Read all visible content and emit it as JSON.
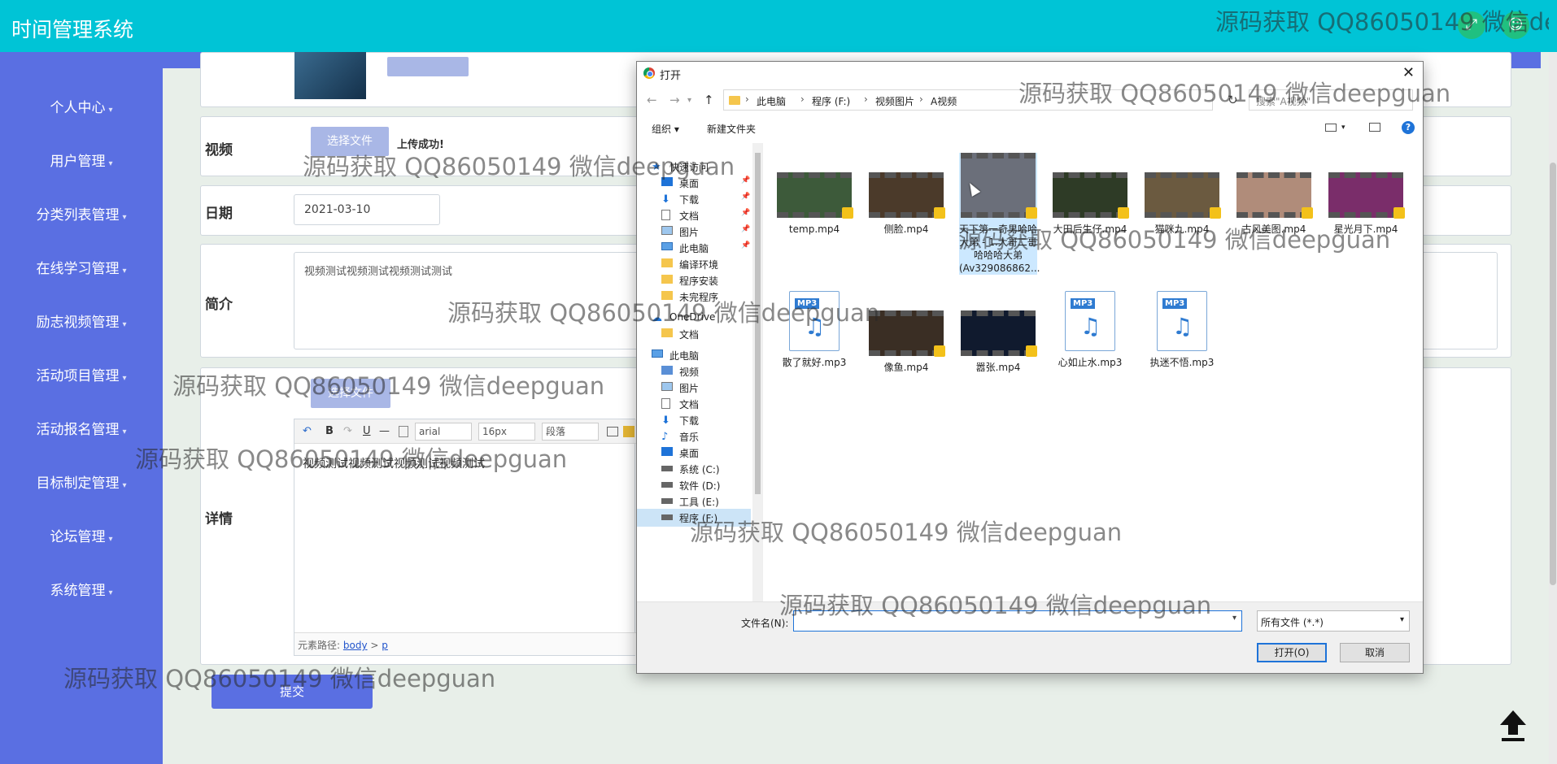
{
  "app": {
    "title": "时间管理系统"
  },
  "sidebar": {
    "items": [
      {
        "label": "个人中心"
      },
      {
        "label": "用户管理"
      },
      {
        "label": "分类列表管理"
      },
      {
        "label": "在线学习管理"
      },
      {
        "label": "励志视频管理"
      },
      {
        "label": "活动项目管理"
      },
      {
        "label": "活动报名管理"
      },
      {
        "label": "目标制定管理"
      },
      {
        "label": "论坛管理"
      },
      {
        "label": "系统管理"
      }
    ],
    "caret": "▾"
  },
  "form": {
    "video_label": "视频",
    "choose_file_label": "选择文件",
    "upload_success": "上传成功!",
    "date_label": "日期",
    "date_value": "2021-03-10",
    "intro_label": "简介",
    "intro_value": "视频测试视频测试视频测试测试",
    "detail_label": "详情",
    "choose_file_label_2": "选择文件",
    "submit_label": "提交"
  },
  "editor": {
    "toolbar": {
      "undo": "↶",
      "redo": "↷",
      "bold": "B",
      "italic": "I",
      "underline": "U",
      "hr": "—",
      "font": "arial",
      "size": "16px",
      "paragraph": "段落"
    },
    "content": "视频测试视频测试视频测试视频测试",
    "path_label": "元素路径:",
    "path_body": "body",
    "path_sep": ">",
    "path_p": "p"
  },
  "dialog": {
    "title": "打开",
    "close": "✕",
    "breadcrumb": [
      "此电脑",
      "程序 (F:)",
      "视频图片",
      "A视频"
    ],
    "breadcrumb_sep": "›",
    "search_placeholder": "搜索\"A视频\"",
    "commands": {
      "organize": "组织 ▾",
      "new_folder": "新建文件夹",
      "help": "?"
    },
    "nav_items": [
      {
        "label": "快速访问",
        "type": "star"
      },
      {
        "label": "桌面",
        "type": "desktop",
        "pin": "📌"
      },
      {
        "label": "下载",
        "type": "download",
        "pin": "📌"
      },
      {
        "label": "文档",
        "type": "doc",
        "pin": "📌"
      },
      {
        "label": "图片",
        "type": "pic",
        "pin": "📌"
      },
      {
        "label": "此电脑",
        "type": "pc",
        "pin": "📌"
      },
      {
        "label": "编译环境",
        "type": "folder"
      },
      {
        "label": "程序安装",
        "type": "folder"
      },
      {
        "label": "未完程序",
        "type": "folder"
      },
      {
        "label": "OneDrive",
        "type": "cloud"
      },
      {
        "label": "文档",
        "type": "folder"
      },
      {
        "label": "此电脑",
        "type": "pc"
      },
      {
        "label": "视频",
        "type": "video"
      },
      {
        "label": "图片",
        "type": "pic"
      },
      {
        "label": "文档",
        "type": "doc"
      },
      {
        "label": "下载",
        "type": "download"
      },
      {
        "label": "音乐",
        "type": "music"
      },
      {
        "label": "桌面",
        "type": "desktop"
      },
      {
        "label": "系统 (C:)",
        "type": "drive"
      },
      {
        "label": "软件 (D:)",
        "type": "drive"
      },
      {
        "label": "工具 (E:)",
        "type": "drive"
      },
      {
        "label": "程序 (F:)",
        "type": "drive",
        "selected": true
      }
    ],
    "files": [
      {
        "name": "temp.mp4",
        "kind": "video",
        "color": "#3d5a3a"
      },
      {
        "name": "侧脸.mp4",
        "kind": "video",
        "color": "#4b3a2a"
      },
      {
        "name": "天下第一奇男哈哈大弟 - 1.大哥二哥哈哈哈大弟(Av329086862...",
        "kind": "video",
        "color": "#6b6f7a",
        "selected": true
      },
      {
        "name": "大田后生仔.mp4",
        "kind": "video",
        "color": "#2e3b26"
      },
      {
        "name": "猫咪九.mp4",
        "kind": "video",
        "color": "#6b5a40"
      },
      {
        "name": "古风美图.mp4",
        "kind": "video",
        "color": "#b08c7a"
      },
      {
        "name": "星光月下.mp4",
        "kind": "video",
        "color": "#7a2d6a"
      },
      {
        "name": "散了就好.mp3",
        "kind": "mp3"
      },
      {
        "name": "像鱼.mp4",
        "kind": "video",
        "color": "#3a2e24"
      },
      {
        "name": "嚣张.mp4",
        "kind": "video",
        "color": "#101a2e"
      },
      {
        "name": "心如止水.mp3",
        "kind": "mp3"
      },
      {
        "name": "执迷不悟.mp3",
        "kind": "mp3"
      }
    ],
    "filename_label": "文件名(N):",
    "filename_value": "",
    "filetype_value": "所有文件 (*.*)",
    "open_label": "打开(O)",
    "cancel_label": "取消"
  },
  "watermark": "源码获取 QQ86050149 微信deepguan",
  "colors": {
    "header": "#00c4d6",
    "sidebar": "#5a6fe2",
    "accent": "#1e73d8"
  }
}
